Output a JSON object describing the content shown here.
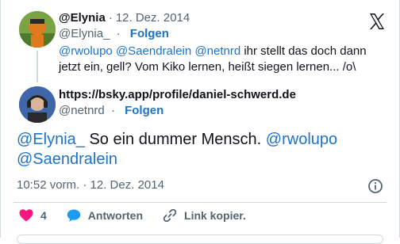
{
  "parent_tweet": {
    "display_name": "@Elynia",
    "date": "12. Dez. 2014",
    "handle": "@Elynia_",
    "follow_label": "Folgen",
    "mentions": [
      "@rwolupo",
      "@Saendralein",
      "@netnrd"
    ],
    "text": "ihr stellt das doch dann jetzt ein, gell?  Vom Kiko lernen, heißt siegen lernen... /o\\"
  },
  "reply_author": {
    "display_name": "https://bsky.app/profile/daniel-schwerd.de",
    "handle": "@netnrd",
    "follow_label": "Folgen"
  },
  "reply": {
    "mention_1": "@Elynia_",
    "text": "So ein dummer Mensch.",
    "mention_2": "@rwolupo",
    "mention_3": "@Saendralein",
    "timestamp": "10:52 vorm. · 12. Dez. 2014"
  },
  "actions": {
    "like_count": "4",
    "reply_label": "Antworten",
    "copy_link_label": "Link kopier."
  },
  "colors": {
    "link": "#1d72c9",
    "like": "#f91880",
    "reply_bubble": "#1d9bf0",
    "muted": "#536471"
  },
  "icons": [
    "x-logo-icon",
    "info-icon",
    "heart-icon",
    "speech-bubble-icon",
    "link-icon"
  ]
}
